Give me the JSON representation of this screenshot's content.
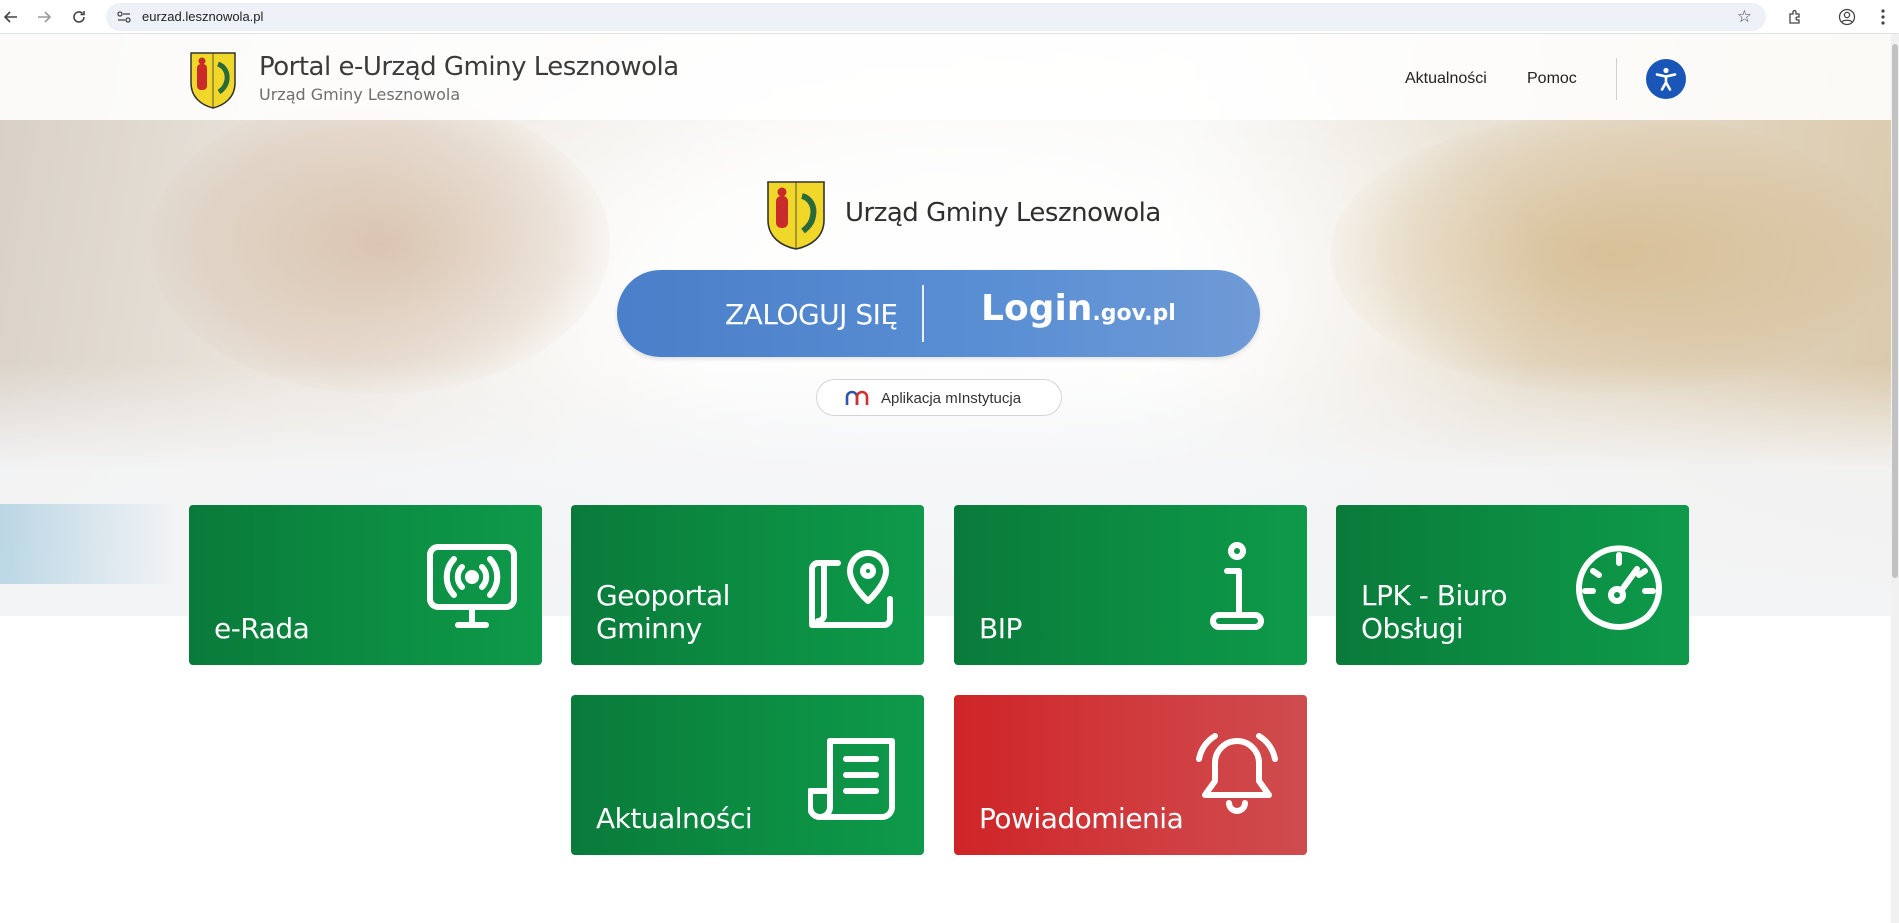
{
  "browser": {
    "url": "eurzad.lesznowola.pl"
  },
  "header": {
    "portal_title": "Portal e-Urząd Gminy Lesznowola",
    "portal_subtitle": "Urząd Gminy Lesznowola",
    "nav": [
      "Aktualności",
      "Pomoc"
    ],
    "accessibility_icon": "accessibility-icon"
  },
  "hero": {
    "office_title": "Urząd Gminy Lesznowola",
    "login_label": "ZALOGUJ SIĘ",
    "login_gov_main": "Login",
    "login_gov_suffix": ".gov.pl",
    "app_label": "Aplikacja mInstytucja"
  },
  "tiles": [
    {
      "label": "e-Rada",
      "icon": "monitor-broadcast-icon",
      "color": "#0b8a41"
    },
    {
      "label": "Geoportal\nGminny",
      "icon": "map-pin-icon",
      "color": "#0b8a41"
    },
    {
      "label": "BIP",
      "icon": "info-icon",
      "color": "#0b8a41"
    },
    {
      "label": "LPK - Biuro\nObsługi",
      "icon": "gauge-icon",
      "color": "#0b8a41"
    },
    {
      "label": "Aktualności",
      "icon": "newspaper-icon",
      "color": "#0b8a41"
    },
    {
      "label": "Powiadomienia",
      "icon": "bell-icon",
      "color": "#cf2427"
    }
  ],
  "colors": {
    "accent_blue": "#1a56b8",
    "login_blue": "#5a8fd4",
    "tile_green": "#0b8a41",
    "tile_red": "#cf2427"
  }
}
